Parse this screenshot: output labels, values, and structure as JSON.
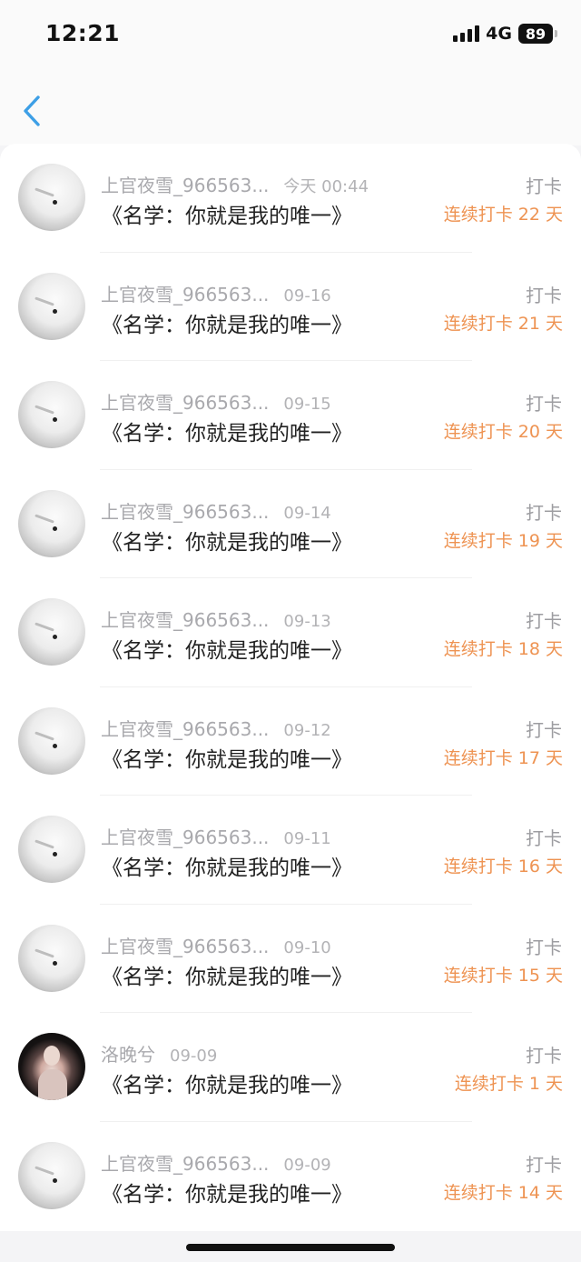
{
  "status_bar": {
    "time": "12:21",
    "network": "4G",
    "battery": "89"
  },
  "nav": {
    "back_icon": "chevron-left-icon",
    "accent_color": "#3d9fe6"
  },
  "colors": {
    "streak": "#ee9352",
    "meta": "#a9a9ad",
    "title": "#222222"
  },
  "entries": [
    {
      "name": "上官夜雪_966563...",
      "time": "今天 00:44",
      "title": "《名学：你就是我的唯一》",
      "action": "打卡",
      "streak": "连续打卡 22 天",
      "avatar": "fox"
    },
    {
      "name": "上官夜雪_966563...",
      "time": "09-16",
      "title": "《名学：你就是我的唯一》",
      "action": "打卡",
      "streak": "连续打卡 21 天",
      "avatar": "fox"
    },
    {
      "name": "上官夜雪_966563...",
      "time": "09-15",
      "title": "《名学：你就是我的唯一》",
      "action": "打卡",
      "streak": "连续打卡 20 天",
      "avatar": "fox"
    },
    {
      "name": "上官夜雪_966563...",
      "time": "09-14",
      "title": "《名学：你就是我的唯一》",
      "action": "打卡",
      "streak": "连续打卡 19 天",
      "avatar": "fox"
    },
    {
      "name": "上官夜雪_966563...",
      "time": "09-13",
      "title": "《名学：你就是我的唯一》",
      "action": "打卡",
      "streak": "连续打卡 18 天",
      "avatar": "fox"
    },
    {
      "name": "上官夜雪_966563...",
      "time": "09-12",
      "title": "《名学：你就是我的唯一》",
      "action": "打卡",
      "streak": "连续打卡 17 天",
      "avatar": "fox"
    },
    {
      "name": "上官夜雪_966563...",
      "time": "09-11",
      "title": "《名学：你就是我的唯一》",
      "action": "打卡",
      "streak": "连续打卡 16 天",
      "avatar": "fox"
    },
    {
      "name": "上官夜雪_966563...",
      "time": "09-10",
      "title": "《名学：你就是我的唯一》",
      "action": "打卡",
      "streak": "连续打卡 15 天",
      "avatar": "fox"
    },
    {
      "name": "洛晚兮",
      "time": "09-09",
      "title": "《名学：你就是我的唯一》",
      "action": "打卡",
      "streak": "连续打卡 1 天",
      "avatar": "girl"
    },
    {
      "name": "上官夜雪_966563...",
      "time": "09-09",
      "title": "《名学：你就是我的唯一》",
      "action": "打卡",
      "streak": "连续打卡 14 天",
      "avatar": "fox"
    }
  ]
}
